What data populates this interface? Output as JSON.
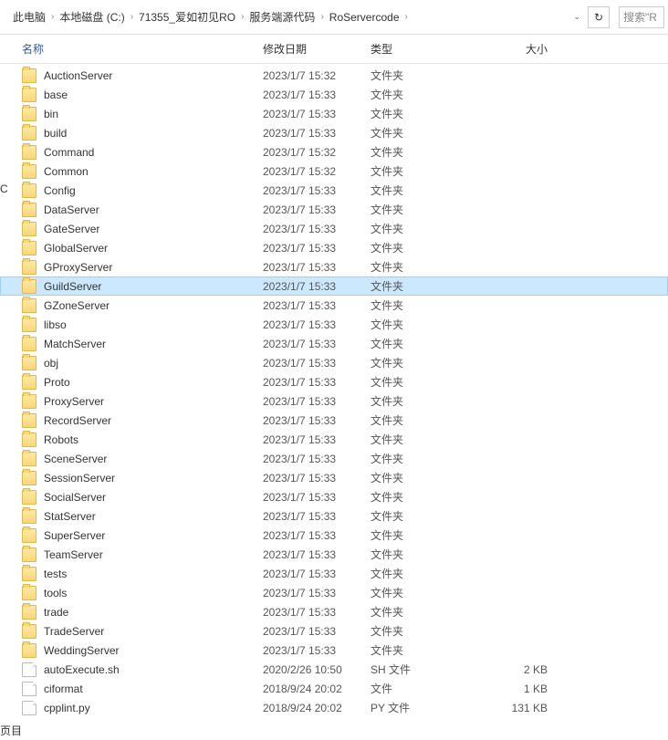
{
  "breadcrumb": {
    "items": [
      "此电脑",
      "本地磁盘 (C:)",
      "71355_爱如初见RO",
      "服务端源代码",
      "RoServercode"
    ]
  },
  "refresh_glyph": "↻",
  "dropdown_glyph": "⌄",
  "search_placeholder": "搜索\"R",
  "columns": {
    "name": "名称",
    "date": "修改日期",
    "type": "类型",
    "size": "大小"
  },
  "selected_index": 11,
  "rows": [
    {
      "icon": "folder",
      "name": "AuctionServer",
      "date": "2023/1/7 15:32",
      "type": "文件夹",
      "size": ""
    },
    {
      "icon": "folder",
      "name": "base",
      "date": "2023/1/7 15:33",
      "type": "文件夹",
      "size": ""
    },
    {
      "icon": "folder",
      "name": "bin",
      "date": "2023/1/7 15:33",
      "type": "文件夹",
      "size": ""
    },
    {
      "icon": "folder",
      "name": "build",
      "date": "2023/1/7 15:33",
      "type": "文件夹",
      "size": ""
    },
    {
      "icon": "folder",
      "name": "Command",
      "date": "2023/1/7 15:32",
      "type": "文件夹",
      "size": ""
    },
    {
      "icon": "folder",
      "name": "Common",
      "date": "2023/1/7 15:32",
      "type": "文件夹",
      "size": ""
    },
    {
      "icon": "folder",
      "name": "Config",
      "date": "2023/1/7 15:33",
      "type": "文件夹",
      "size": ""
    },
    {
      "icon": "folder",
      "name": "DataServer",
      "date": "2023/1/7 15:33",
      "type": "文件夹",
      "size": ""
    },
    {
      "icon": "folder",
      "name": "GateServer",
      "date": "2023/1/7 15:33",
      "type": "文件夹",
      "size": ""
    },
    {
      "icon": "folder",
      "name": "GlobalServer",
      "date": "2023/1/7 15:33",
      "type": "文件夹",
      "size": ""
    },
    {
      "icon": "folder",
      "name": "GProxyServer",
      "date": "2023/1/7 15:33",
      "type": "文件夹",
      "size": ""
    },
    {
      "icon": "folder",
      "name": "GuildServer",
      "date": "2023/1/7 15:33",
      "type": "文件夹",
      "size": ""
    },
    {
      "icon": "folder",
      "name": "GZoneServer",
      "date": "2023/1/7 15:33",
      "type": "文件夹",
      "size": ""
    },
    {
      "icon": "folder",
      "name": "libso",
      "date": "2023/1/7 15:33",
      "type": "文件夹",
      "size": ""
    },
    {
      "icon": "folder",
      "name": "MatchServer",
      "date": "2023/1/7 15:33",
      "type": "文件夹",
      "size": ""
    },
    {
      "icon": "folder",
      "name": "obj",
      "date": "2023/1/7 15:33",
      "type": "文件夹",
      "size": ""
    },
    {
      "icon": "folder",
      "name": "Proto",
      "date": "2023/1/7 15:33",
      "type": "文件夹",
      "size": ""
    },
    {
      "icon": "folder",
      "name": "ProxyServer",
      "date": "2023/1/7 15:33",
      "type": "文件夹",
      "size": ""
    },
    {
      "icon": "folder",
      "name": "RecordServer",
      "date": "2023/1/7 15:33",
      "type": "文件夹",
      "size": ""
    },
    {
      "icon": "folder",
      "name": "Robots",
      "date": "2023/1/7 15:33",
      "type": "文件夹",
      "size": ""
    },
    {
      "icon": "folder",
      "name": "SceneServer",
      "date": "2023/1/7 15:33",
      "type": "文件夹",
      "size": ""
    },
    {
      "icon": "folder",
      "name": "SessionServer",
      "date": "2023/1/7 15:33",
      "type": "文件夹",
      "size": ""
    },
    {
      "icon": "folder",
      "name": "SocialServer",
      "date": "2023/1/7 15:33",
      "type": "文件夹",
      "size": ""
    },
    {
      "icon": "folder",
      "name": "StatServer",
      "date": "2023/1/7 15:33",
      "type": "文件夹",
      "size": ""
    },
    {
      "icon": "folder",
      "name": "SuperServer",
      "date": "2023/1/7 15:33",
      "type": "文件夹",
      "size": ""
    },
    {
      "icon": "folder",
      "name": "TeamServer",
      "date": "2023/1/7 15:33",
      "type": "文件夹",
      "size": ""
    },
    {
      "icon": "folder",
      "name": "tests",
      "date": "2023/1/7 15:33",
      "type": "文件夹",
      "size": ""
    },
    {
      "icon": "folder",
      "name": "tools",
      "date": "2023/1/7 15:33",
      "type": "文件夹",
      "size": ""
    },
    {
      "icon": "folder",
      "name": "trade",
      "date": "2023/1/7 15:33",
      "type": "文件夹",
      "size": ""
    },
    {
      "icon": "folder",
      "name": "TradeServer",
      "date": "2023/1/7 15:33",
      "type": "文件夹",
      "size": ""
    },
    {
      "icon": "folder",
      "name": "WeddingServer",
      "date": "2023/1/7 15:33",
      "type": "文件夹",
      "size": ""
    },
    {
      "icon": "file",
      "name": "autoExecute.sh",
      "date": "2020/2/26 10:50",
      "type": "SH 文件",
      "size": "2 KB"
    },
    {
      "icon": "file",
      "name": "ciformat",
      "date": "2018/9/24 20:02",
      "type": "文件",
      "size": "1 KB"
    },
    {
      "icon": "file",
      "name": "cpplint.py",
      "date": "2018/9/24 20:02",
      "type": "PY 文件",
      "size": "131 KB"
    }
  ],
  "left_edge_text": "C",
  "bottom_edge_text": "页目"
}
